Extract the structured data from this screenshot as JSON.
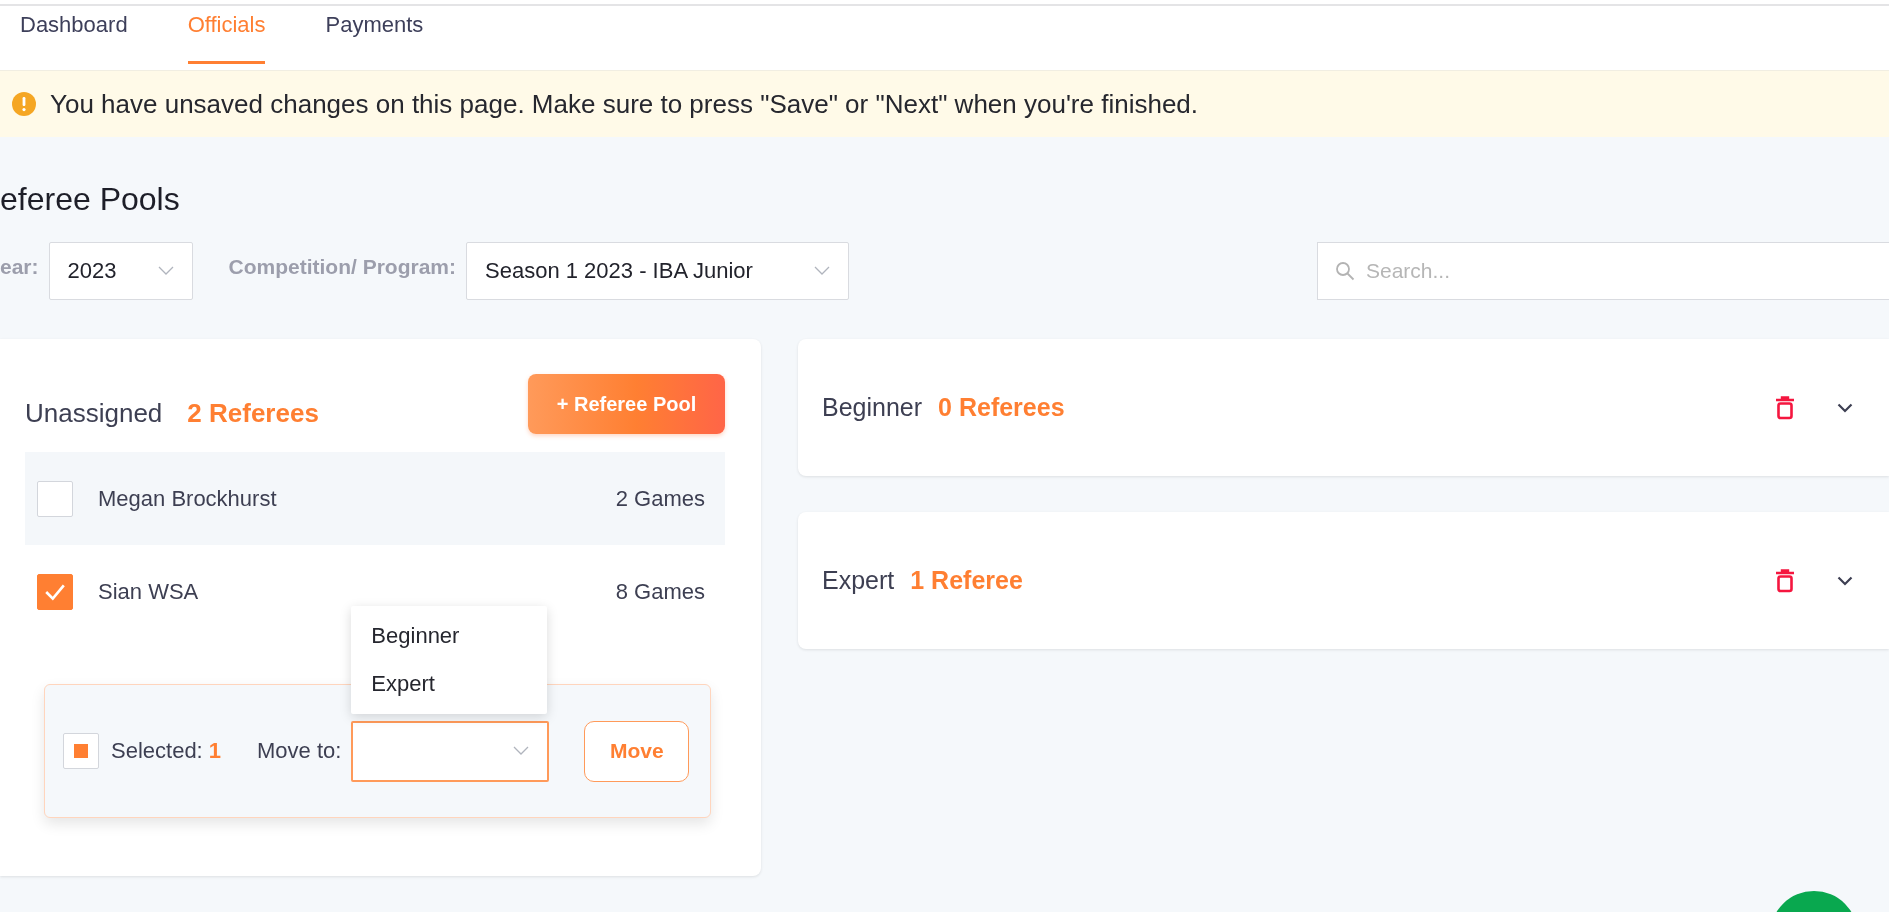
{
  "tabs": [
    {
      "label": "Dashboard",
      "selected": false
    },
    {
      "label": "Officials",
      "selected": true
    },
    {
      "label": "Payments",
      "selected": false
    }
  ],
  "banner": {
    "text": "You have unsaved changes on this page. Make sure to press \"Save\" or \"Next\" when you're finished."
  },
  "title": "eferee Pools",
  "filters": {
    "year_label": "ear:",
    "year": "2023",
    "competition_label": "Competition/ Program:",
    "competition": "Season 1 2023 - IBA Junior",
    "search_placeholder": "Search..."
  },
  "unassigned": {
    "title": "Unassigned",
    "count": "2 Referees",
    "add_button": "+ Referee Pool",
    "referees": [
      {
        "name": "Megan Brockhurst",
        "games": "2 Games",
        "checked": false
      },
      {
        "name": "Sian WSA",
        "games": "8 Games",
        "checked": true
      }
    ],
    "bulk": {
      "select_all_partial": true,
      "selected_label": "Selected:",
      "selected_count": "1",
      "move_label": "Move to:",
      "move_button": "Move",
      "menu_open": true,
      "menu_options": [
        "Beginner",
        "Expert"
      ]
    }
  },
  "pools": [
    {
      "name": "Beginner",
      "count": "0 Referees",
      "expanded": false
    },
    {
      "name": "Expert",
      "count": "1 Referee",
      "expanded": false
    }
  ]
}
